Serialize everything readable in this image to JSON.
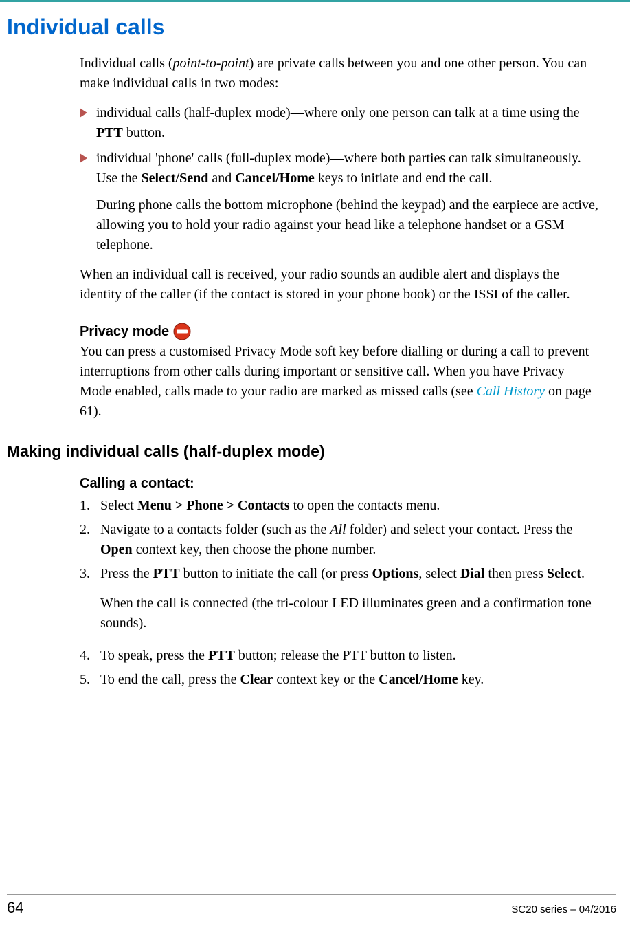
{
  "title": "Individual calls",
  "intro": {
    "p1_a": "Individual calls (",
    "p1_i": "point-to-point",
    "p1_b": ") are private calls between you and one other person. You can make individual calls in two modes:"
  },
  "bullets": {
    "b1_a": "individual calls (half-duplex mode)—where only one person can talk at a time using the ",
    "b1_bold": "PTT",
    "b1_b": " button.",
    "b2_a": "individual 'phone' calls (full-duplex mode)—where both parties can talk simultaneously. Use the ",
    "b2_bold1": "Select/Send",
    "b2_mid": " and ",
    "b2_bold2": "Cancel/Home",
    "b2_b": " keys to initiate and end the call.",
    "b2_sub": "During phone calls the bottom microphone (behind the keypad) and the earpiece are active, allowing you to hold your radio against your head like a telephone handset or a GSM telephone."
  },
  "after_bullets": "When an individual call is received, your radio sounds an audible alert and displays the identity of the caller (if the contact is stored in your phone book) or the ISSI of the caller.",
  "privacy": {
    "heading": "Privacy mode",
    "p_a": "You can press a customised Privacy Mode soft key before dialling or during a call to prevent interruptions from other calls during important or sensitive call. When you have Privacy Mode enabled, calls made to your radio are marked as missed calls (see ",
    "link": "Call History",
    "p_b": " on page 61)."
  },
  "section2": "Making individual calls (half-duplex mode)",
  "calling": {
    "heading": "Calling a contact:",
    "s1_a": "Select ",
    "s1_bold": "Menu > Phone > Contacts",
    "s1_b": " to open the contacts menu.",
    "s2_a": "Navigate to a contacts folder (such as the ",
    "s2_i": "All",
    "s2_b": " folder) and select your contact. Press the ",
    "s2_bold": "Open",
    "s2_c": " context key, then choose the phone number.",
    "s3_a": "Press the ",
    "s3_bold1": "PTT",
    "s3_b": " button to initiate the call (or press ",
    "s3_bold2": "Options",
    "s3_c": ", select ",
    "s3_bold3": "Dial",
    "s3_d": " then press ",
    "s3_bold4": "Select",
    "s3_e": ".",
    "s3_sub": "When the call is connected (the tri-colour LED illuminates green and a confirmation tone sounds).",
    "s4_a": "To speak, press the ",
    "s4_bold": "PTT",
    "s4_b": " button; release the PTT button to listen.",
    "s5_a": "To end the call, press the ",
    "s5_bold1": "Clear",
    "s5_b": " context key or the ",
    "s5_bold2": "Cancel/Home",
    "s5_c": " key."
  },
  "footer": {
    "page": "64",
    "doc": "SC20 series – 04/2016"
  }
}
